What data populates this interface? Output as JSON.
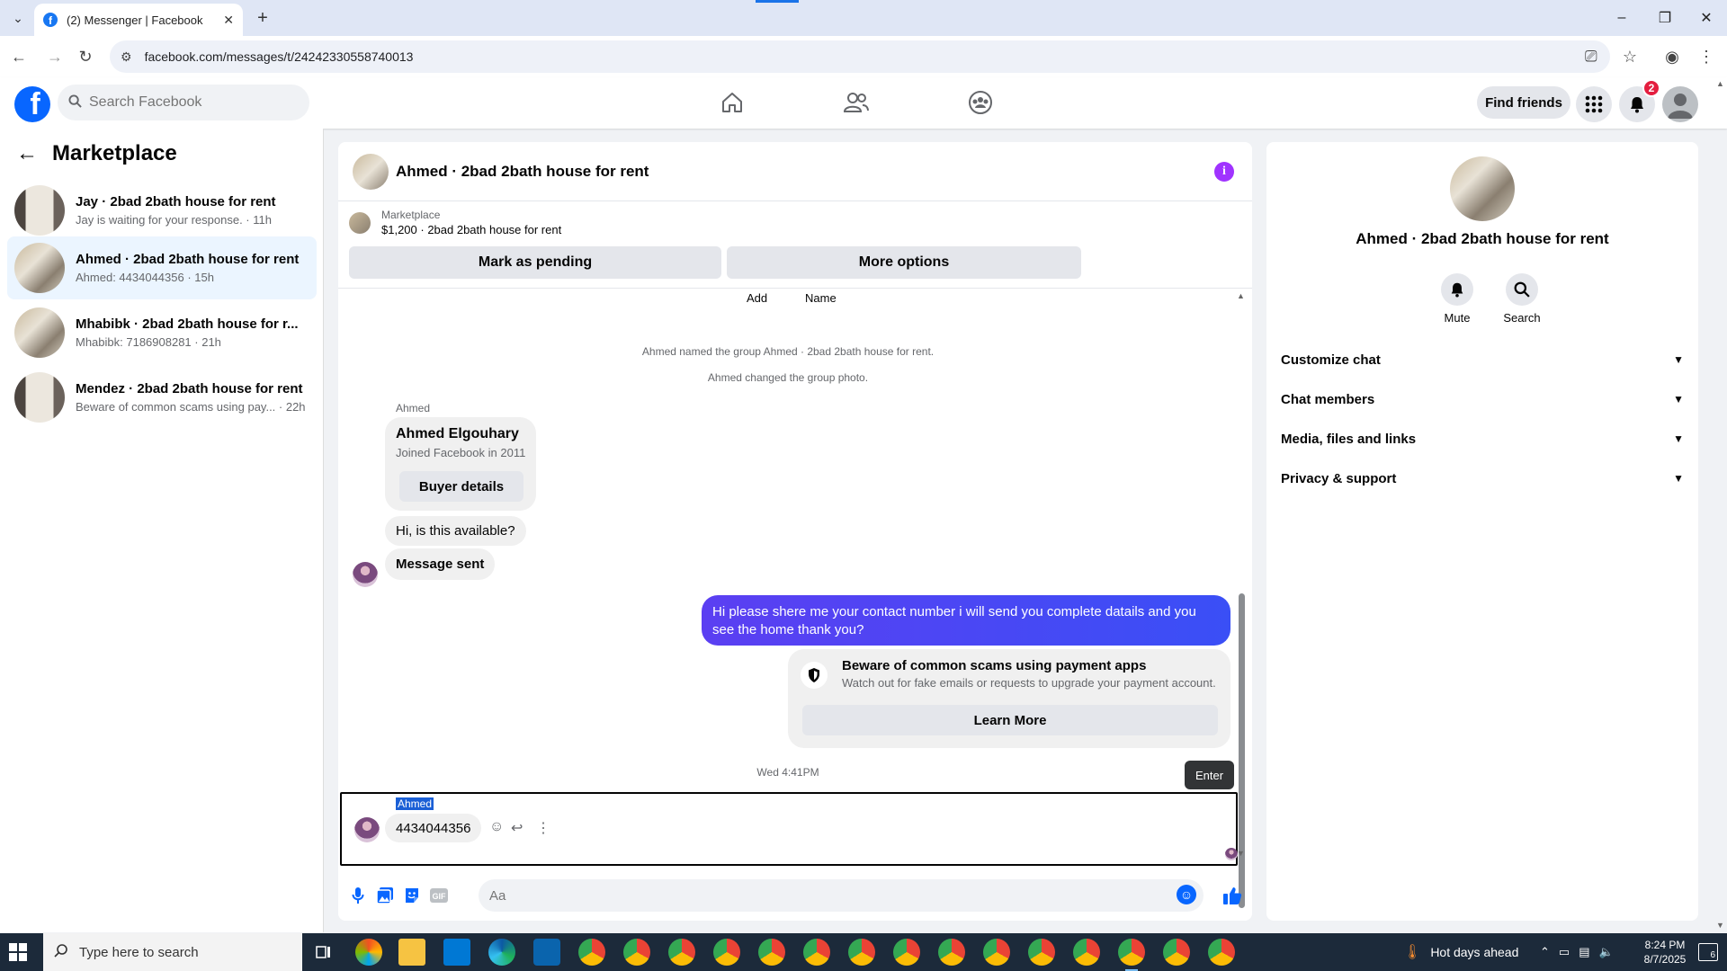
{
  "browser": {
    "tab_title": "(2) Messenger | Facebook",
    "url": "facebook.com/messages/t/24242330558740013"
  },
  "fb": {
    "search_placeholder": "Search Facebook",
    "find_friends": "Find friends",
    "notification_count": "2"
  },
  "sidebar": {
    "title": "Marketplace",
    "conversations": [
      {
        "title": "Jay · 2bad 2bath house for rent",
        "preview": "Jay is waiting for your response. · 11h",
        "active": false
      },
      {
        "title": "Ahmed · 2bad 2bath house for rent",
        "preview": "Ahmed: 4434044356 · 15h",
        "active": true
      },
      {
        "title": "Mhabibk · 2bad 2bath house for r...",
        "preview": "Mhabibk: 7186908281 · 21h",
        "active": false
      },
      {
        "title": "Mendez · 2bad 2bath house for rent",
        "preview": "Beware of common scams using pay... · 22h",
        "active": false
      }
    ]
  },
  "chat": {
    "title": "Ahmed · 2bad 2bath house for rent",
    "marketplace_label": "Marketplace",
    "listing": "$1,200 · 2bad 2bath house for rent",
    "mark_pending": "Mark as pending",
    "more_options": "More options",
    "col_add": "Add",
    "col_name": "Name",
    "sys_named": "Ahmed named the group Ahmed · 2bad 2bath house for rent.",
    "sys_photo": "Ahmed changed the group photo.",
    "sender_name": "Ahmed",
    "buyer_name": "Ahmed Elgouhary",
    "buyer_joined": "Joined Facebook in 2011",
    "buyer_details": "Buyer details",
    "msg_available": "Hi, is this available?",
    "msg_sent": "Message sent",
    "my_message": "Hi please shere me your contact number i will send you complete datails and you see the home thank you?",
    "scam_title": "Beware of common scams using payment apps",
    "scam_sub": "Watch out for fake emails or requests to upgrade your payment account.",
    "learn_more": "Learn More",
    "timestamp": "Wed 4:41PM",
    "tooltip": "Enter",
    "reply_sender": "Ahmed",
    "reply_text": "4434044356",
    "composer_placeholder": "Aa"
  },
  "details": {
    "name": "Ahmed · 2bad 2bath house for rent",
    "mute": "Mute",
    "search": "Search",
    "sections": [
      "Customize chat",
      "Chat members",
      "Media, files and links",
      "Privacy & support"
    ]
  },
  "taskbar": {
    "search_placeholder": "Type here to search",
    "weather": "Hot days ahead",
    "time": "8:24 PM",
    "date": "8/7/2025",
    "notif_count": "6"
  },
  "colors": {
    "fb_blue": "#0866ff",
    "my_bubble": "#4c3bf5",
    "badge_red": "#e41e3f"
  }
}
